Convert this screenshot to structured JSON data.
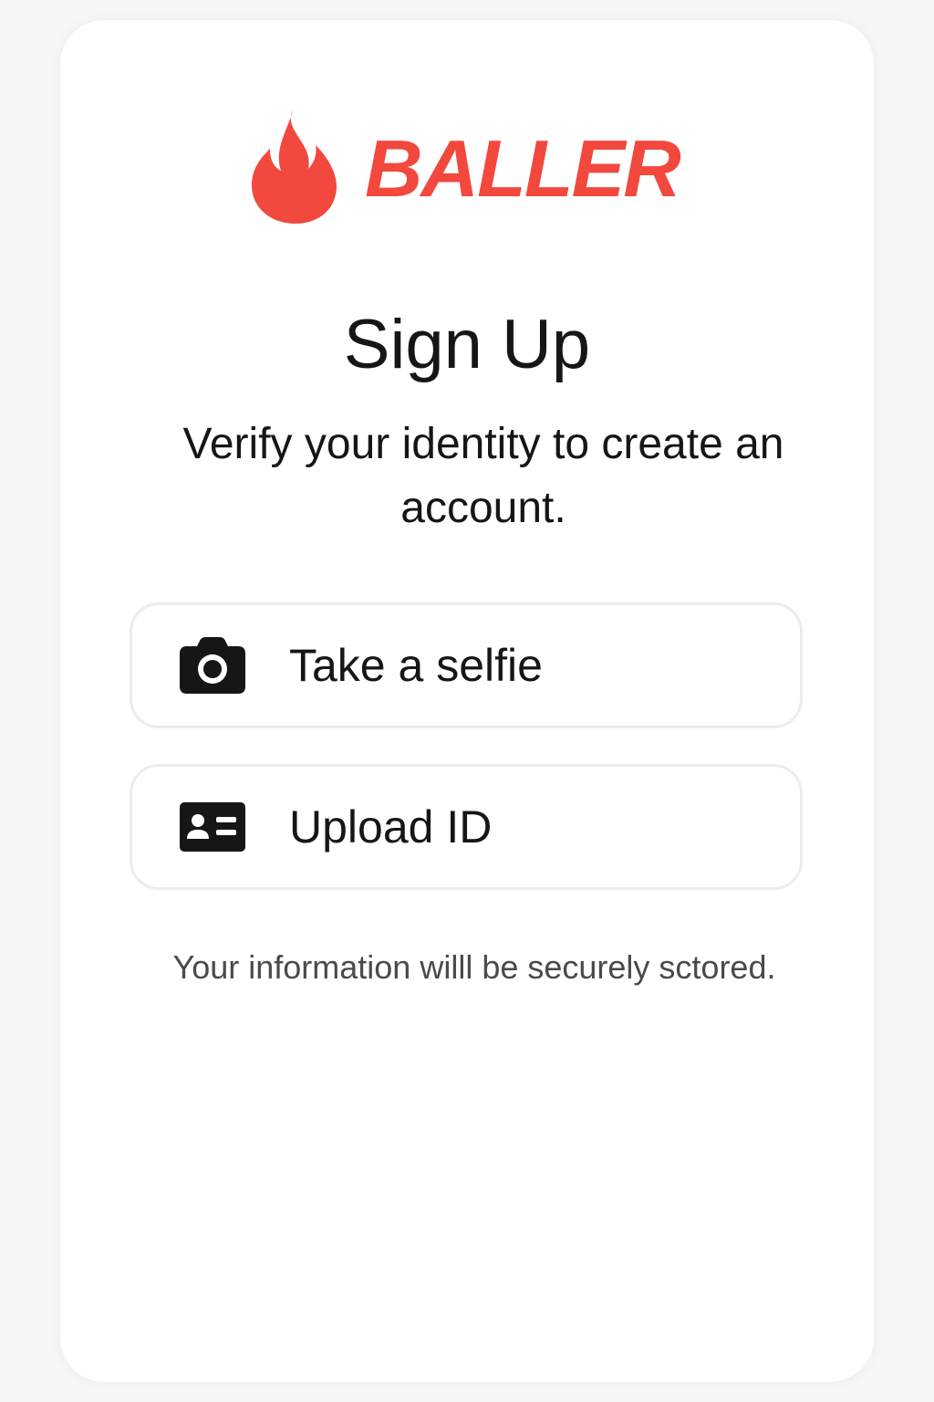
{
  "brand": {
    "name": "BALLER",
    "color": "#f2483d",
    "icon": "flame-icon"
  },
  "header": {
    "title": "Sign Up",
    "subtitle": "Verify your identity to create an account."
  },
  "actions": [
    {
      "label": "Take a selfie",
      "icon": "camera-icon"
    },
    {
      "label": "Upload ID",
      "icon": "id-card-icon"
    }
  ],
  "footer": {
    "note": "Your information willl be securely sctored."
  }
}
